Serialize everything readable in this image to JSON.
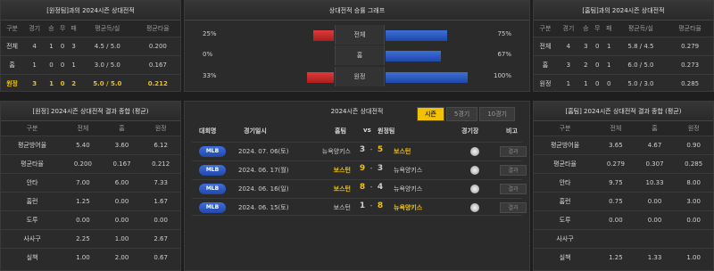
{
  "left_top": {
    "title": "[원정팀]과의 2024시즌 상대전적",
    "headers": [
      "구분",
      "경기",
      "승",
      "무",
      "패",
      "평균득/실",
      "평균타율"
    ],
    "rows": [
      [
        "전체",
        "4",
        "1",
        "0",
        "3",
        "4.5 / 5.0",
        "0.200"
      ],
      [
        "홈",
        "1",
        "0",
        "0",
        "1",
        "3.0 / 5.0",
        "0.167"
      ],
      [
        "원정",
        "3",
        "1",
        "0",
        "2",
        "5.0 / 5.0",
        "0.212"
      ]
    ]
  },
  "right_top": {
    "title": "[홈팀]과의 2024시즌 상대전적",
    "headers": [
      "구분",
      "경기",
      "승",
      "무",
      "패",
      "평균득/실",
      "평균타율"
    ],
    "rows": [
      [
        "전체",
        "4",
        "3",
        "0",
        "1",
        "5.8 / 4.5",
        "0.279"
      ],
      [
        "홈",
        "3",
        "2",
        "0",
        "1",
        "6.0 / 5.0",
        "0.273"
      ],
      [
        "원정",
        "1",
        "1",
        "0",
        "0",
        "5.0 / 3.0",
        "0.285"
      ]
    ]
  },
  "center_top": {
    "title": "상대전적 승률 그래프",
    "rows": [
      {
        "left_pct": "25%",
        "label": "전체",
        "right_pct": "75%",
        "left_val": 25,
        "right_val": 75
      },
      {
        "left_pct": "0%",
        "label": "홈",
        "right_pct": "67%",
        "left_val": 0,
        "right_val": 67
      },
      {
        "left_pct": "33%",
        "label": "원정",
        "right_pct": "100%",
        "left_val": 33,
        "right_val": 100
      }
    ]
  },
  "left_bottom": {
    "title": "[원정] 2024시즌 상대전적 결과 종합 (평균)",
    "headers": [
      "구분",
      "전체",
      "홈",
      "원정"
    ],
    "rows": [
      [
        "평균방어율",
        "5.40",
        "3.60",
        "6.12"
      ],
      [
        "평균타율",
        "0.200",
        "0.167",
        "0.212"
      ],
      [
        "안타",
        "7.00",
        "6.00",
        "7.33"
      ],
      [
        "홈런",
        "1.25",
        "0.00",
        "1.67"
      ],
      [
        "도루",
        "0.00",
        "0.00",
        "0.00"
      ],
      [
        "사사구",
        "2.25",
        "1.00",
        "2.67"
      ],
      [
        "실책",
        "1.00",
        "2.00",
        "0.67"
      ]
    ]
  },
  "right_bottom": {
    "title": "[홈팀] 2024시즌 상대전적 결과 종합 (평균)",
    "headers": [
      "구분",
      "전체",
      "홈",
      "원정"
    ],
    "rows": [
      [
        "평균방어율",
        "3.65",
        "4.67",
        "0.90"
      ],
      [
        "평균타율",
        "0.279",
        "0.307",
        "0.285"
      ],
      [
        "안타",
        "9.75",
        "10.33",
        "8.00"
      ],
      [
        "홈런",
        "0.75",
        "0.00",
        "3.00"
      ],
      [
        "도루",
        "0.00",
        "0.00",
        "0.00"
      ],
      [
        "사사구",
        "",
        "",
        ""
      ],
      [
        "실책",
        "1.25",
        "1.33",
        "1.00"
      ]
    ]
  },
  "schedule": {
    "title": "2024시즌 상대전적",
    "tabs": [
      "시즌",
      "5경기",
      "10경기"
    ],
    "headers": {
      "league": "대회명",
      "date": "경기일시",
      "home": "홈팀",
      "vs": "vs",
      "away": "원정팀",
      "view": "경기장",
      "note": "비고"
    },
    "games": [
      {
        "league": "MLB",
        "date": "2024. 07. 06(토)",
        "home": "뉴욕양키스",
        "s1": "3",
        "s2": "5",
        "away": "보스턴",
        "btn": "결과"
      },
      {
        "league": "MLB",
        "date": "2024. 06. 17(월)",
        "home": "보스턴",
        "s1": "9",
        "s2": "3",
        "away": "뉴욕양키스",
        "btn": "결과"
      },
      {
        "league": "MLB",
        "date": "2024. 06. 16(일)",
        "home": "보스턴",
        "s1": "8",
        "s2": "4",
        "away": "뉴욕양키스",
        "btn": "결과"
      },
      {
        "league": "MLB",
        "date": "2024. 06. 15(토)",
        "home": "보스턴",
        "s1": "1",
        "s2": "8",
        "away": "뉴욕양키스",
        "btn": "결과"
      }
    ]
  }
}
